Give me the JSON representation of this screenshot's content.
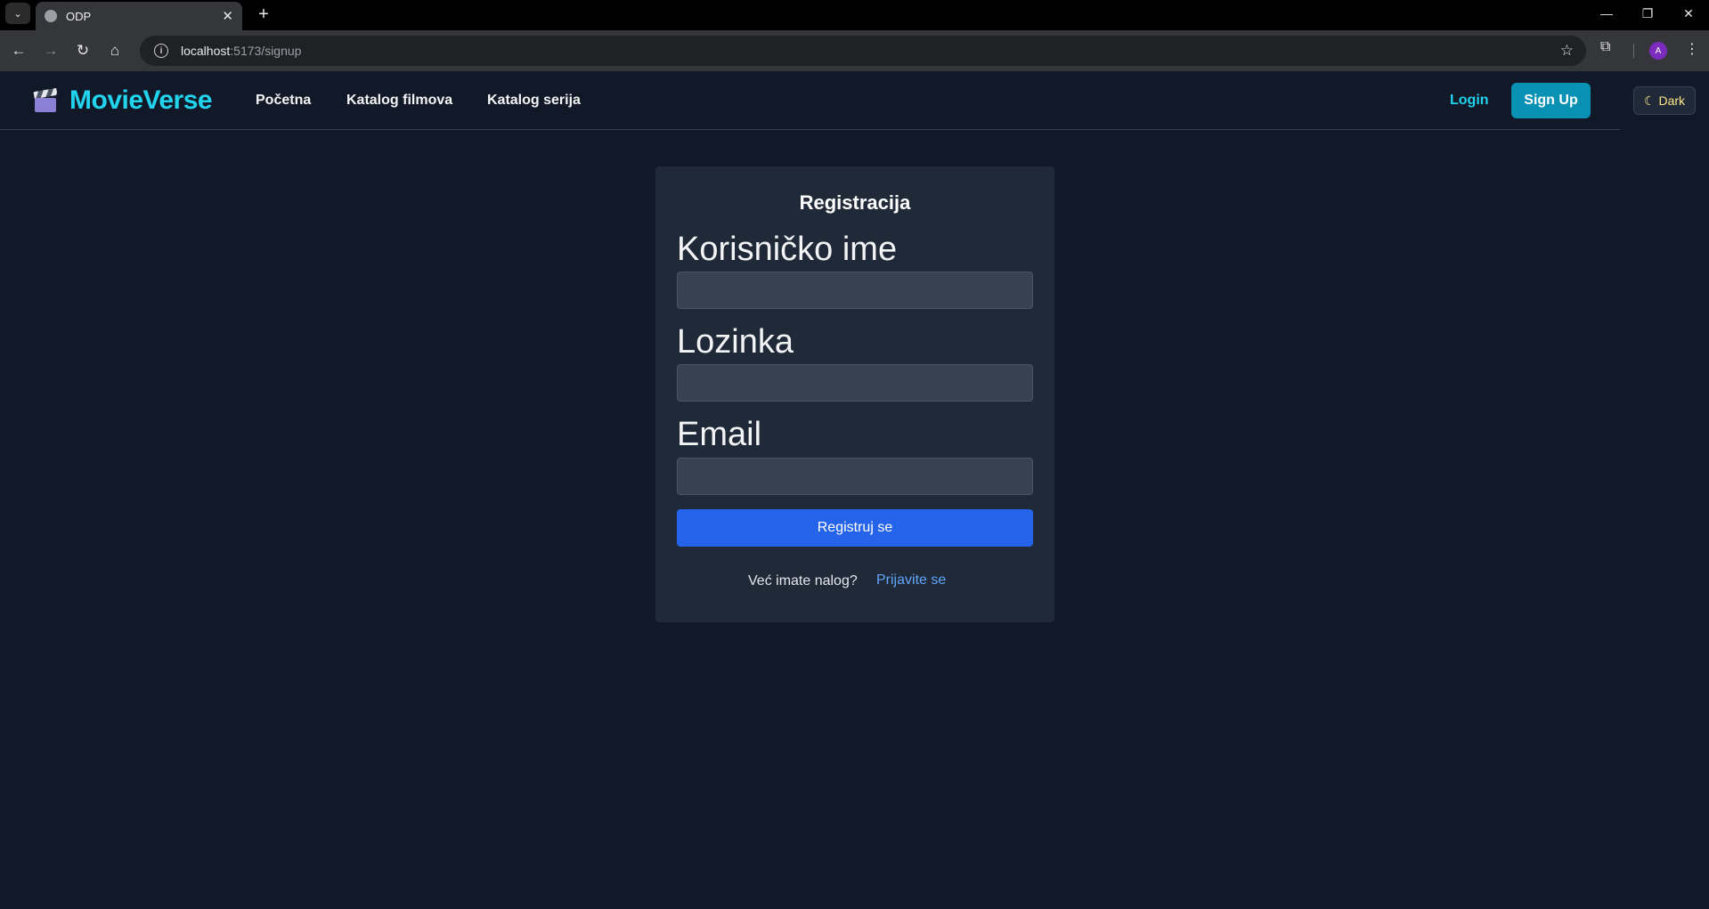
{
  "browser": {
    "tab_title": "ODP",
    "url_host": "localhost",
    "url_path": ":5173/signup",
    "avatar_letter": "A"
  },
  "app": {
    "brand": "MovieVerse",
    "nav": [
      "Početna",
      "Katalog filmova",
      "Katalog serija"
    ],
    "login_label": "Login",
    "signup_label": "Sign Up",
    "theme_label": "Dark"
  },
  "form": {
    "title": "Registracija",
    "username_label": "Korisničko ime",
    "password_label": "Lozinka",
    "email_label": "Email",
    "username_value": "",
    "password_value": "",
    "email_value": "",
    "submit_label": "Registruj se",
    "footer_text": "Već imate nalog?",
    "footer_link": "Prijavite se"
  },
  "colors": {
    "accent": "#22d3ee",
    "primary_button": "#2563eb",
    "background": "#111827"
  }
}
